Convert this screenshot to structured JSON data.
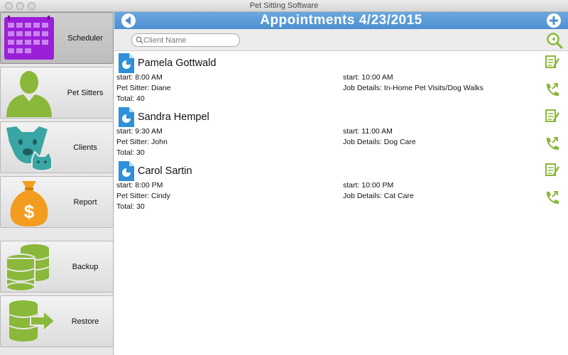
{
  "window": {
    "title": "Pet Sitting Software"
  },
  "sidebar": {
    "items": [
      {
        "label": "Scheduler",
        "icon": "calendar-icon",
        "active": true
      },
      {
        "label": "Pet Sitters",
        "icon": "person-icon",
        "active": false
      },
      {
        "label": "Clients",
        "icon": "dog-cat-icon",
        "active": false
      },
      {
        "label": "Report",
        "icon": "money-bag-icon",
        "active": false
      },
      {
        "label": "Backup",
        "icon": "database-backup-icon",
        "active": false
      },
      {
        "label": "Restore",
        "icon": "database-restore-icon",
        "active": false
      }
    ]
  },
  "header": {
    "title": "Appointments 4/23/2015",
    "back_icon": "back-arrow-icon",
    "add_icon": "add-icon"
  },
  "search": {
    "placeholder": "Client Name",
    "value": ""
  },
  "appointments": [
    {
      "client": "Pamela Gottwald",
      "start": "start: 8:00 AM",
      "end": "start: 10:00 AM",
      "sitter": "Pet Sitter: Diane",
      "details": "Job Details: In-Home Pet Visits/Dog Walks",
      "total": "Total: 40"
    },
    {
      "client": "Sandra Hempel",
      "start": "start: 9:30 AM",
      "end": "start: 11:00 AM",
      "sitter": "Pet Sitter: John",
      "details": "Job Details: Dog Care",
      "total": "Total: 30"
    },
    {
      "client": "Carol Sartin",
      "start": "start: 8:00 PM",
      "end": "start: 10:00 PM",
      "sitter": "Pet Sitter: Cindy",
      "details": "Job Details: Cat Care",
      "total": "Total: 30"
    }
  ],
  "colors": {
    "accent": "#4d8fd0",
    "green": "#8ab83a",
    "purple": "#9b1fd8",
    "orange": "#f39c1f",
    "teal": "#3aa5a5"
  }
}
